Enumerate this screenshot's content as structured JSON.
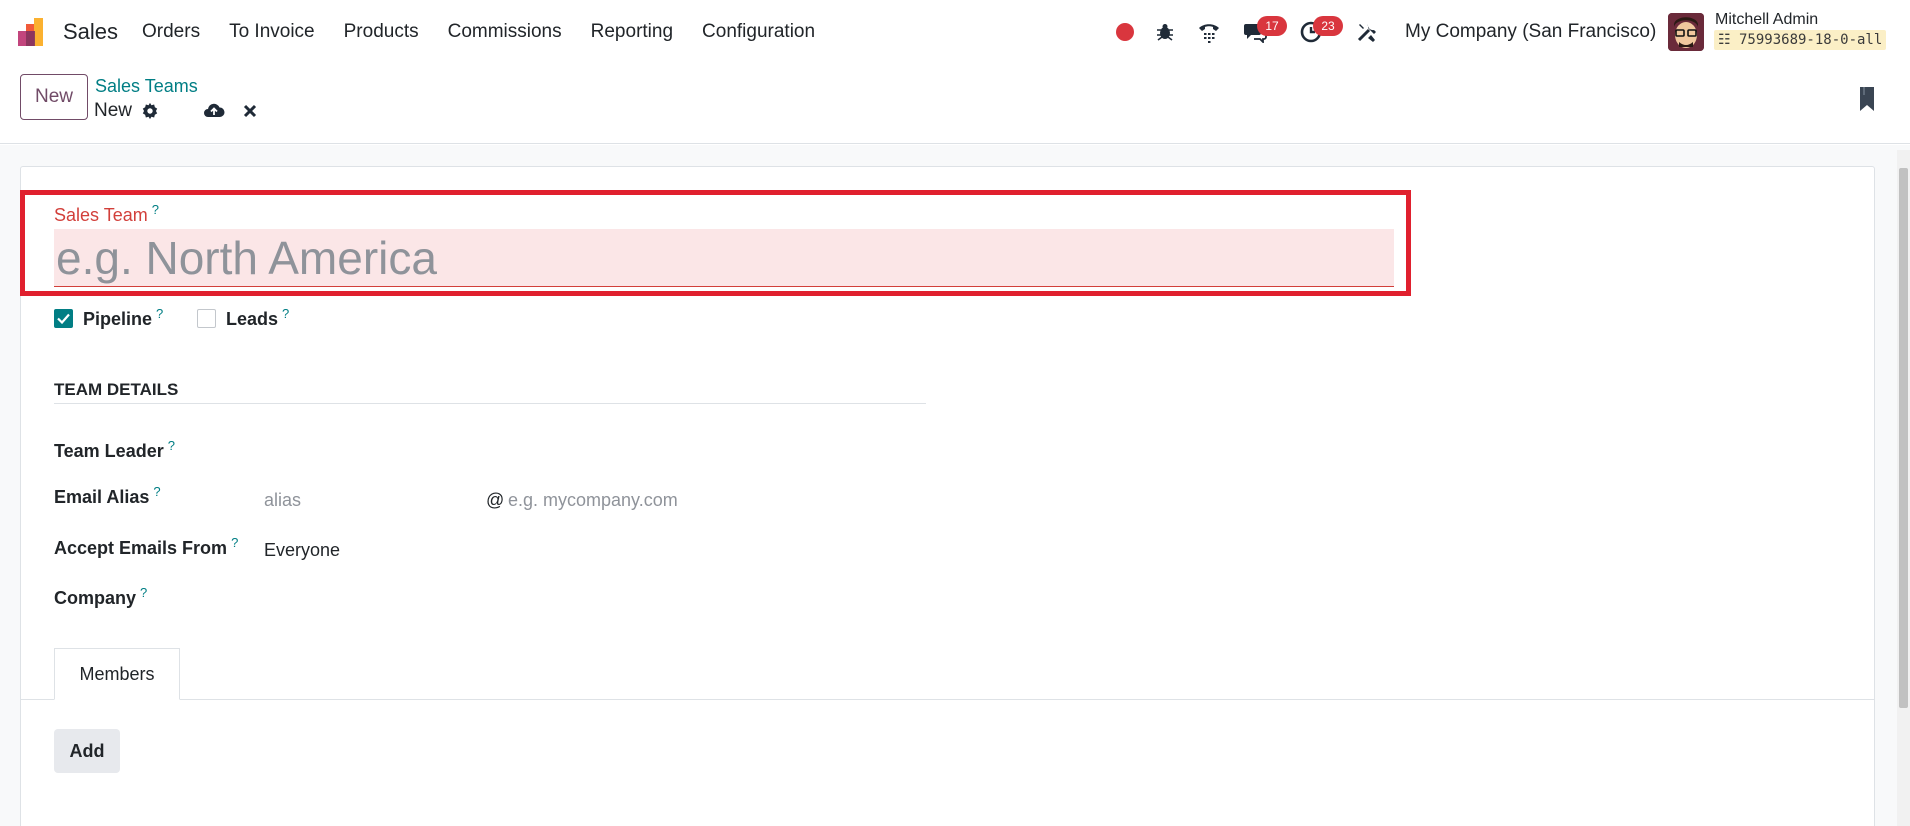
{
  "navbar": {
    "app_name": "Sales",
    "menu": [
      {
        "label": "Orders"
      },
      {
        "label": "To Invoice"
      },
      {
        "label": "Products"
      },
      {
        "label": "Commissions"
      },
      {
        "label": "Reporting"
      },
      {
        "label": "Configuration"
      }
    ],
    "messages_count": "17",
    "activities_count": "23",
    "company": "My Company (San Francisco)",
    "user_name": "Mitchell Admin",
    "database": "75993689-18-0-all"
  },
  "control_panel": {
    "new_label": "New",
    "breadcrumb": "Sales Teams",
    "record_name": "New"
  },
  "form": {
    "name_label": "Sales Team",
    "help_mark": "?",
    "name_placeholder": "e.g. North America",
    "pipeline_label": "Pipeline",
    "pipeline_checked": true,
    "leads_label": "Leads",
    "leads_checked": false,
    "section_title": "TEAM DETAILS",
    "team_leader_label": "Team Leader",
    "email_alias_label": "Email Alias",
    "alias_placeholder": "alias",
    "domain_at": "@",
    "domain_placeholder": "e.g. mycompany.com",
    "accept_emails_label": "Accept Emails From",
    "accept_emails_value": "Everyone",
    "company_label": "Company",
    "tab_members": "Members",
    "add_label": "Add"
  },
  "colors": {
    "brand": "#714b67",
    "accent": "#017e84",
    "required": "#d23f3a",
    "highlight": "#e0202e",
    "badge": "#d9363e"
  }
}
